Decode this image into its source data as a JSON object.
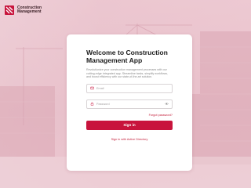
{
  "brand": {
    "name_line1": "Construction",
    "name_line2": "Management",
    "logo_icon": "brand-logo-icon",
    "accent_color": "#c8143c"
  },
  "login": {
    "title": "Welcome to Construction Management App",
    "description": "Revolutionize your construction management processes with our cutting-edge integrated app. Streamline tasks, simplify workflows, and boost efficiency with our state-of-the-art solution.",
    "email": {
      "placeholder": "Email",
      "value": "",
      "icon": "mail-icon"
    },
    "password": {
      "placeholder": "Password",
      "value": "",
      "icon": "lock-icon",
      "toggle_icon": "eye-icon"
    },
    "forgot_password_label": "Forgot password?",
    "sign_in_label": "Sign in",
    "active_directory_label": "Sign in with Active Directory"
  }
}
